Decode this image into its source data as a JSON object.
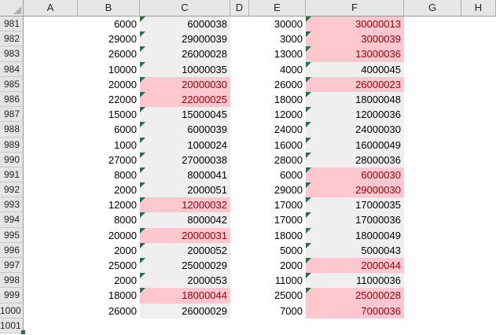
{
  "app": {
    "type": "spreadsheet-grid"
  },
  "colors": {
    "cell_fill_gray": "#efefef",
    "bad_fill": "#ffc7ce",
    "bad_text": "#9c0006",
    "error_indicator_green": "#1f7244",
    "selection_green": "#217346",
    "header_bg": "#e6e6e6"
  },
  "column_headers": [
    "A",
    "B",
    "C",
    "D",
    "E",
    "F",
    "G",
    "H"
  ],
  "rows": [
    {
      "n": "981",
      "b": "6000",
      "c": "6000038",
      "cBad": false,
      "e": "30000",
      "f": "30000013",
      "fBad": true,
      "fill": true,
      "indicator": true
    },
    {
      "n": "982",
      "b": "29000",
      "c": "29000039",
      "cBad": false,
      "e": "3000",
      "f": "3000039",
      "fBad": true,
      "fill": true,
      "indicator": true
    },
    {
      "n": "983",
      "b": "26000",
      "c": "26000028",
      "cBad": false,
      "e": "13000",
      "f": "13000036",
      "fBad": true,
      "fill": true,
      "indicator": true
    },
    {
      "n": "984",
      "b": "10000",
      "c": "10000035",
      "cBad": false,
      "e": "4000",
      "f": "4000045",
      "fBad": false,
      "fill": true,
      "indicator": true
    },
    {
      "n": "985",
      "b": "20000",
      "c": "20000030",
      "cBad": true,
      "e": "26000",
      "f": "26000023",
      "fBad": true,
      "fill": true,
      "indicator": true
    },
    {
      "n": "986",
      "b": "22000",
      "c": "22000025",
      "cBad": true,
      "e": "18000",
      "f": "18000048",
      "fBad": false,
      "fill": true,
      "indicator": true
    },
    {
      "n": "987",
      "b": "15000",
      "c": "15000045",
      "cBad": false,
      "e": "12000",
      "f": "12000036",
      "fBad": false,
      "fill": true,
      "indicator": true
    },
    {
      "n": "988",
      "b": "6000",
      "c": "6000039",
      "cBad": false,
      "e": "24000",
      "f": "24000030",
      "fBad": false,
      "fill": true,
      "indicator": true
    },
    {
      "n": "989",
      "b": "1000",
      "c": "1000024",
      "cBad": false,
      "e": "16000",
      "f": "16000049",
      "fBad": false,
      "fill": true,
      "indicator": true
    },
    {
      "n": "990",
      "b": "27000",
      "c": "27000038",
      "cBad": false,
      "e": "28000",
      "f": "28000036",
      "fBad": false,
      "fill": true,
      "indicator": true
    },
    {
      "n": "991",
      "b": "8000",
      "c": "8000041",
      "cBad": false,
      "e": "6000",
      "f": "6000030",
      "fBad": true,
      "fill": true,
      "indicator": true
    },
    {
      "n": "992",
      "b": "2000",
      "c": "2000051",
      "cBad": false,
      "e": "29000",
      "f": "29000030",
      "fBad": true,
      "fill": true,
      "indicator": true
    },
    {
      "n": "993",
      "b": "12000",
      "c": "12000032",
      "cBad": true,
      "e": "17000",
      "f": "17000035",
      "fBad": false,
      "fill": true,
      "indicator": true
    },
    {
      "n": "994",
      "b": "8000",
      "c": "8000042",
      "cBad": false,
      "e": "17000",
      "f": "17000036",
      "fBad": false,
      "fill": true,
      "indicator": true
    },
    {
      "n": "995",
      "b": "20000",
      "c": "20000031",
      "cBad": true,
      "e": "18000",
      "f": "18000049",
      "fBad": false,
      "fill": true,
      "indicator": true
    },
    {
      "n": "996",
      "b": "2000",
      "c": "2000052",
      "cBad": false,
      "e": "5000",
      "f": "5000043",
      "fBad": false,
      "fill": true,
      "indicator": true
    },
    {
      "n": "997",
      "b": "25000",
      "c": "25000029",
      "cBad": false,
      "e": "2000",
      "f": "2000044",
      "fBad": true,
      "fill": true,
      "indicator": true
    },
    {
      "n": "998",
      "b": "2000",
      "c": "2000053",
      "cBad": false,
      "e": "11000",
      "f": "11000036",
      "fBad": false,
      "fill": true,
      "indicator": true
    },
    {
      "n": "999",
      "b": "18000",
      "c": "18000044",
      "cBad": true,
      "e": "25000",
      "f": "25000028",
      "fBad": true,
      "fill": true,
      "indicator": true
    },
    {
      "n": "1000",
      "b": "26000",
      "c": "26000029",
      "cBad": false,
      "e": "7000",
      "f": "7000036",
      "fBad": true,
      "fill": true,
      "indicator": false
    },
    {
      "n": "1001",
      "b": "",
      "c": "",
      "cBad": false,
      "e": "",
      "f": "",
      "fBad": false,
      "fill": false,
      "indicator": false
    }
  ]
}
